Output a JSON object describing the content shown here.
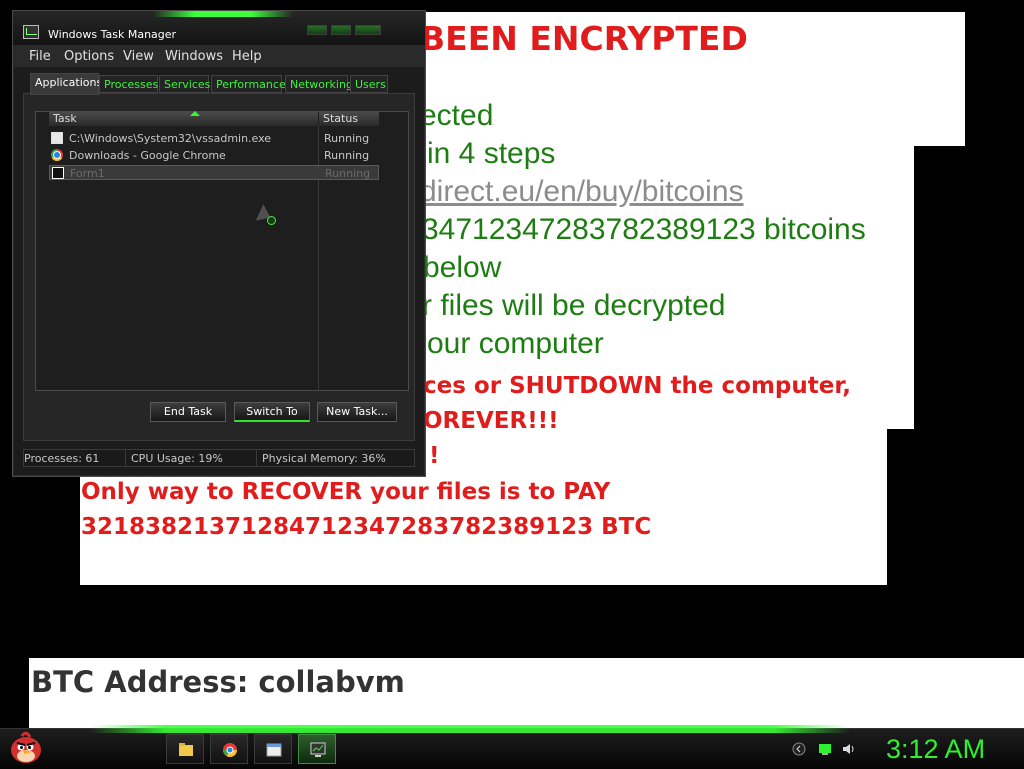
{
  "ransom_note": {
    "title": "BEEN ENCRYPTED",
    "lines": [
      "ected",
      "in 4 steps",
      "direct.eu/en/buy/bitcoins",
      "3471234728378238912​3 bitcoins",
      " below",
      "r files will be decrypted",
      "our computer"
    ],
    "warnings": [
      "ces or SHUTDOWN the computer,",
      "OREVER!!!",
      "!",
      "Only way to RECOVER your files is to PAY",
      "321838213712847123472837823891​23 BTC"
    ],
    "btc_address": "BTC Address: collabvm"
  },
  "task_manager": {
    "title": "Windows Task Manager",
    "menu": [
      "File",
      "Options",
      "View",
      "Windows",
      "Help"
    ],
    "tabs": [
      "Applications",
      "Processes",
      "Services",
      "Performance",
      "Networking",
      "Users"
    ],
    "active_tab": "Applications",
    "columns": [
      "Task",
      "Status"
    ],
    "rows": [
      {
        "task": "C:\\Windows\\System32\\vssadmin.exe",
        "status": "Running",
        "icon": "exe-icon"
      },
      {
        "task": "Downloads - Google Chrome",
        "status": "Running",
        "icon": "chrome-icon"
      },
      {
        "task": "Form1",
        "status": "Running",
        "icon": "form-icon"
      }
    ],
    "buttons": {
      "end_task": "End Task",
      "switch_to": "Switch To",
      "new_task": "New Task..."
    },
    "status": {
      "processes": "Processes: 61",
      "cpu": "CPU Usage: 19%",
      "memory": "Physical Memory: 36%"
    }
  },
  "taskbar": {
    "clock": "3:12 AM",
    "items": [
      "folder-icon",
      "chrome-icon",
      "window-icon",
      "task-manager-icon"
    ],
    "accent_color": "#2ef02e"
  }
}
